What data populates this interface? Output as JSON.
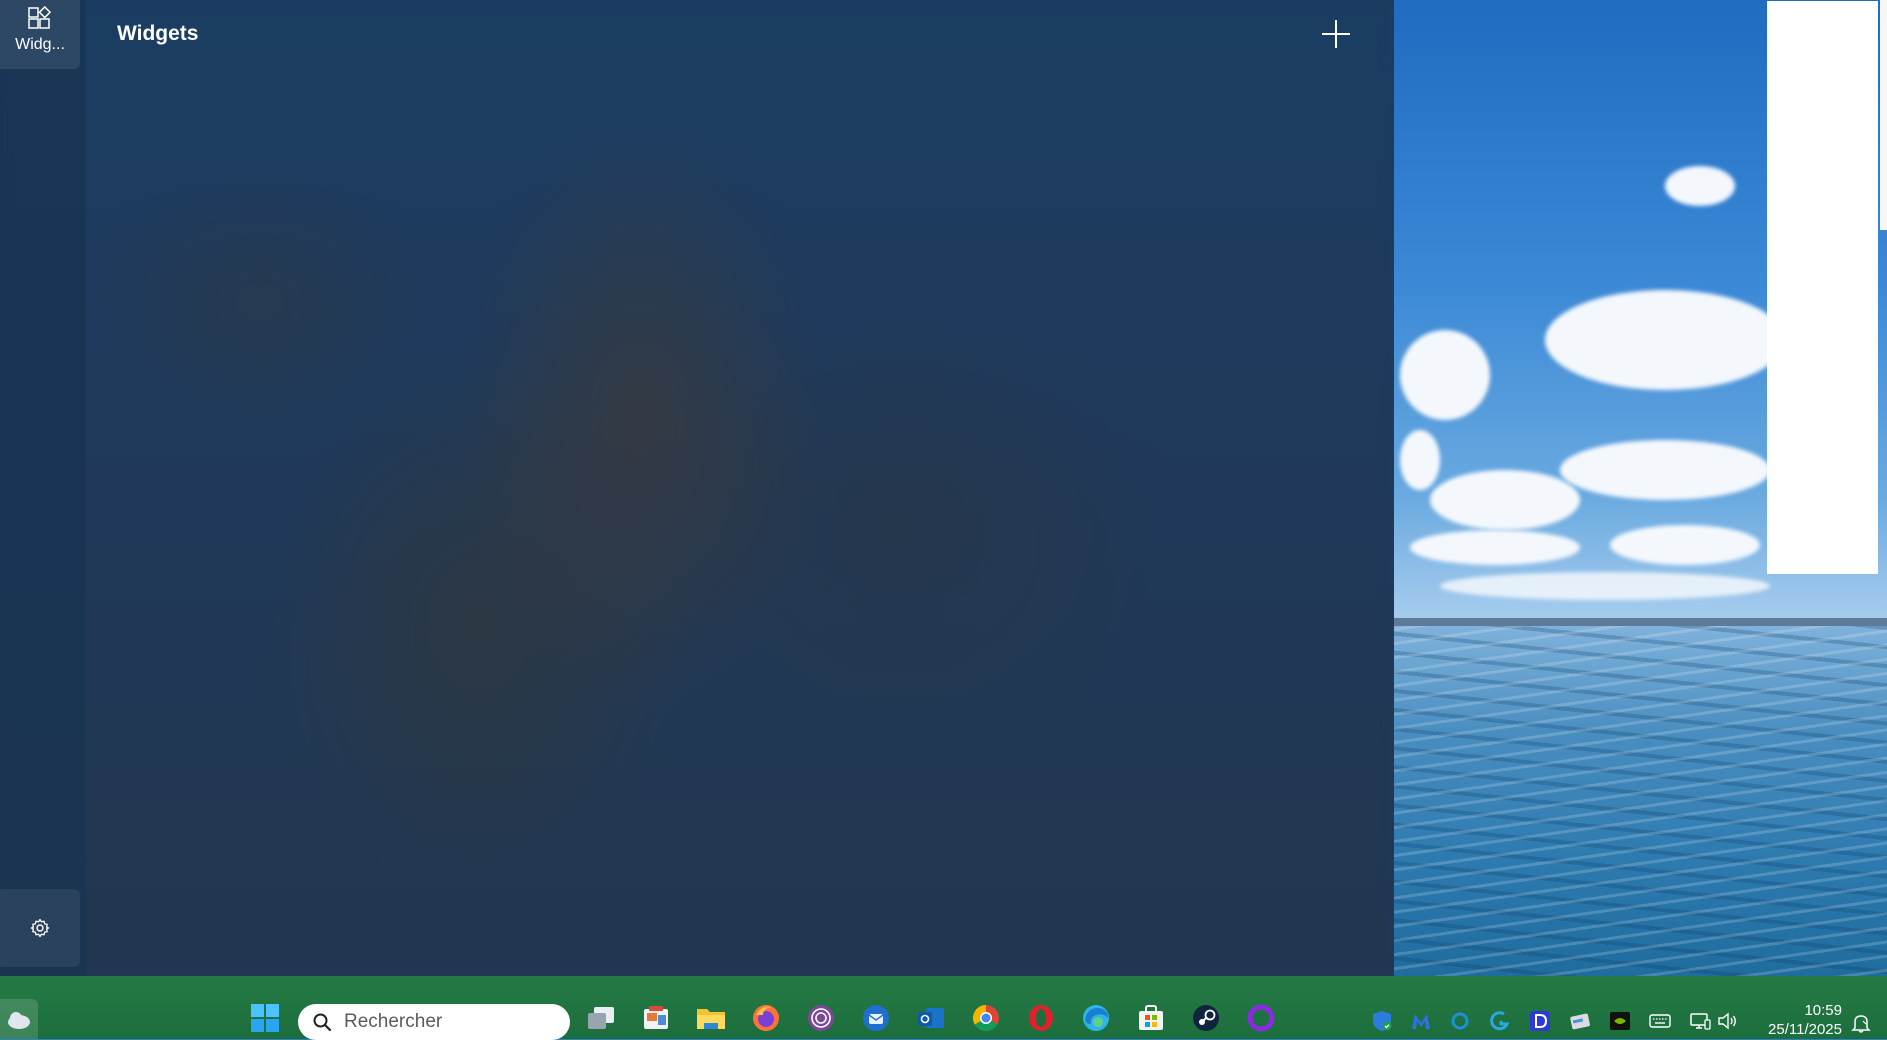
{
  "board": {
    "title": "Widgets",
    "rail_tab_label": "Widg...",
    "rail_tab_icon": "widgets-icon",
    "settings_icon": "gear-icon",
    "add_icon": "plus-icon"
  },
  "taskbar": {
    "search_placeholder": "Rechercher",
    "pinned": [
      {
        "name": "start-button",
        "icon": "windows-logo-icon"
      },
      {
        "name": "task-view",
        "icon": "task-view-icon"
      },
      {
        "name": "app-photos",
        "icon": "photos-icon"
      },
      {
        "name": "app-file-explorer",
        "icon": "folder-icon"
      },
      {
        "name": "app-firefox",
        "icon": "firefox-icon"
      },
      {
        "name": "app-tor",
        "icon": "tor-browser-icon"
      },
      {
        "name": "app-thunderbird",
        "icon": "thunderbird-icon"
      },
      {
        "name": "app-outlook",
        "icon": "outlook-icon"
      },
      {
        "name": "app-chrome",
        "icon": "chrome-icon"
      },
      {
        "name": "app-opera",
        "icon": "opera-icon"
      },
      {
        "name": "app-edge",
        "icon": "edge-icon"
      },
      {
        "name": "app-store",
        "icon": "microsoft-store-icon"
      },
      {
        "name": "app-steam",
        "icon": "steam-icon"
      },
      {
        "name": "app-circle",
        "icon": "purple-ring-icon"
      }
    ],
    "tray": [
      {
        "name": "defender",
        "icon": "shield-icon"
      },
      {
        "name": "malwarebytes",
        "icon": "malwarebytes-icon"
      },
      {
        "name": "app-c",
        "icon": "blue-circle-icon"
      },
      {
        "name": "logitech",
        "icon": "logitech-icon"
      },
      {
        "name": "app-d",
        "icon": "d-badge-icon"
      },
      {
        "name": "app-card",
        "icon": "card-icon"
      },
      {
        "name": "nvidia",
        "icon": "nvidia-icon"
      },
      {
        "name": "keyboard",
        "icon": "keyboard-icon"
      },
      {
        "name": "network",
        "icon": "network-icon"
      },
      {
        "name": "volume",
        "icon": "speaker-icon"
      }
    ],
    "time": "10:59",
    "date": "25/11/2025",
    "notification_icon": "notification-bell-icon"
  },
  "colors": {
    "taskbar": "#1f723f",
    "board": "#1f3a5c",
    "accent": "#0078d4"
  }
}
